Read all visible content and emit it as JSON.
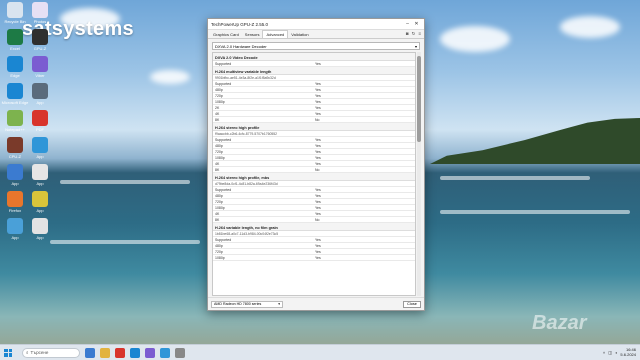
{
  "desktop": {
    "brand_text": "satsystems",
    "watermark_text": "Bazar",
    "icons": [
      {
        "label": "Recycle Bin",
        "icon": "recycle-bin-icon",
        "color": "#d9e4ef"
      },
      {
        "label": "Photos",
        "icon": "photos-icon",
        "color": "#e6e0f4"
      },
      {
        "label": "Excel",
        "icon": "excel-icon",
        "color": "#1d7a45"
      },
      {
        "label": "GPU-Z",
        "icon": "gpuz-icon",
        "color": "#2f2f2f"
      },
      {
        "label": "Edge",
        "icon": "edge-icon",
        "color": "#1a86d2"
      },
      {
        "label": "Viber",
        "icon": "viber-icon",
        "color": "#7b5cd1"
      },
      {
        "label": "Microsoft Edge",
        "icon": "edge-icon",
        "color": "#1a86d2"
      },
      {
        "label": "App",
        "icon": "app-icon",
        "color": "#5a6b7c"
      },
      {
        "label": "Notepad++",
        "icon": "notepad-icon",
        "color": "#7db34e"
      },
      {
        "label": "PDF",
        "icon": "pdf-icon",
        "color": "#d8342c"
      },
      {
        "label": "CPU-Z",
        "icon": "cpuz-icon",
        "color": "#7a3a2a"
      },
      {
        "label": "App",
        "icon": "app-icon",
        "color": "#2f96d8"
      },
      {
        "label": "App",
        "icon": "app-icon",
        "color": "#3b7bd0"
      },
      {
        "label": "App",
        "icon": "app-icon",
        "color": "#e5e5e5"
      },
      {
        "label": "Firefox",
        "icon": "firefox-icon",
        "color": "#e8762c"
      },
      {
        "label": "App",
        "icon": "app-icon",
        "color": "#d9c53a"
      },
      {
        "label": "App",
        "icon": "app-icon",
        "color": "#4aa0d8"
      },
      {
        "label": "App",
        "icon": "app-icon",
        "color": "#e3e3e3"
      }
    ]
  },
  "window": {
    "title": "TechPowerUp GPU-Z 2.55.0",
    "tabs": [
      {
        "label": "Graphics Card",
        "active": false
      },
      {
        "label": "Sensors",
        "active": false
      },
      {
        "label": "Advanced",
        "active": true
      },
      {
        "label": "Validation",
        "active": false
      }
    ],
    "dropdown_value": "DXVA 2.0 Hardware Decoder",
    "sections": [
      {
        "title": "DXVA 2.0 Video Decode",
        "guid": "",
        "rows": [
          [
            "Supported",
            "Yes"
          ]
        ]
      },
      {
        "title": "H.264 multiview variable length",
        "guid": "9901bfbc-ae51-4e3a-8f2e-a1f1f5a9c32d",
        "rows": [
          [
            "Supported",
            "Yes"
          ],
          [
            "480p",
            "Yes"
          ],
          [
            "720p",
            "Yes"
          ],
          [
            "1080p",
            "Yes"
          ],
          [
            "2K",
            "Yes"
          ],
          [
            "4K",
            "Yes"
          ],
          [
            "8K",
            "No"
          ]
        ]
      },
      {
        "title": "H.264 stereo high profile",
        "guid": "f9aaccbb-c2b6-4cfc-8779-5707b1760552",
        "rows": [
          [
            "Supported",
            "Yes"
          ],
          [
            "480p",
            "Yes"
          ],
          [
            "720p",
            "Yes"
          ],
          [
            "1080p",
            "Yes"
          ],
          [
            "4K",
            "Yes"
          ],
          [
            "8K",
            "No"
          ]
        ]
      },
      {
        "title": "H.264 stereo high profile, mbs",
        "guid": "d79be8da-0cf1-4c81-b82a-69a4e236f43d",
        "rows": [
          [
            "Supported",
            "Yes"
          ],
          [
            "480p",
            "Yes"
          ],
          [
            "720p",
            "Yes"
          ],
          [
            "1080p",
            "Yes"
          ],
          [
            "4K",
            "Yes"
          ],
          [
            "8K",
            "No"
          ]
        ]
      },
      {
        "title": "H.264 variable length, no film grain",
        "guid": "1b81be68-a0c7-11d3-b984-00c04f2e73c5",
        "rows": [
          [
            "Supported",
            "Yes"
          ],
          [
            "480p",
            "Yes"
          ],
          [
            "720p",
            "Yes"
          ],
          [
            "1080p",
            "Yes"
          ]
        ]
      }
    ],
    "gpu_select": "AMD Radeon HD 7800 series",
    "close_label": "Close"
  },
  "taskbar": {
    "search_placeholder": "Търсене",
    "time": "16:46",
    "date": "5.6.2024",
    "apps": [
      "#3b7bd0",
      "#e2b340",
      "#d8342c",
      "#1a86d2",
      "#7b5cd1",
      "#2f96d8",
      "#888888"
    ]
  }
}
